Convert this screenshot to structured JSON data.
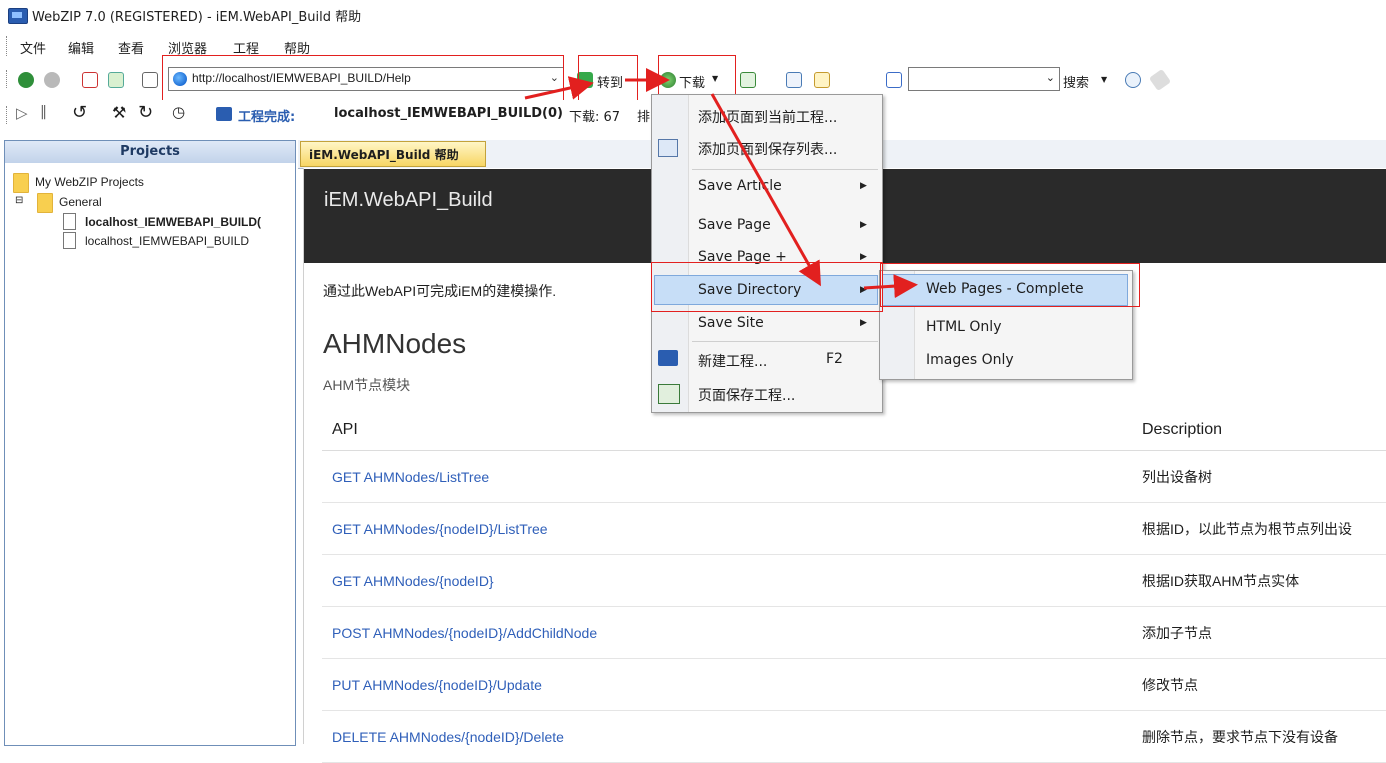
{
  "window": {
    "title": "WebZIP 7.0 (REGISTERED) - iEM.WebAPI_Build 帮助"
  },
  "menubar": {
    "items": [
      "文件",
      "编辑",
      "查看",
      "浏览器",
      "工程",
      "帮助"
    ]
  },
  "toolbar": {
    "address": "http://localhost/IEMWEBAPI_BUILD/Help",
    "go_label": "转到",
    "download_label": "下载",
    "search_label": "搜索",
    "search_value": ""
  },
  "toolbar2": {
    "status_label": "工程完成:",
    "status_project": "localhost_IEMWEBAPI_BUILD(0)",
    "status_download": "下载: 67",
    "status_cut": "排"
  },
  "projects": {
    "header": "Projects",
    "root": "My WebZIP Projects",
    "group": "General",
    "items": [
      "localhost_IEMWEBAPI_BUILD(",
      "localhost_IEMWEBAPI_BUILD"
    ]
  },
  "tab": {
    "label": "iEM.WebAPI_Build 帮助"
  },
  "page": {
    "banner_title": "iEM.WebAPI_Build",
    "intro": "通过此WebAPI可完成iEM的建模操作.",
    "section_title": "AHMNodes",
    "section_sub": "AHM节点模块",
    "table_headers": [
      "API",
      "Description"
    ],
    "rows": [
      {
        "api": "GET AHMNodes/ListTree",
        "desc": "列出设备树"
      },
      {
        "api": "GET AHMNodes/{nodeID}/ListTree",
        "desc": "根据ID，以此节点为根节点列出设"
      },
      {
        "api": "GET AHMNodes/{nodeID}",
        "desc": "根据ID获取AHM节点实体"
      },
      {
        "api": "POST AHMNodes/{nodeID}/AddChildNode",
        "desc": "添加子节点"
      },
      {
        "api": "PUT AHMNodes/{nodeID}/Update",
        "desc": "修改节点"
      },
      {
        "api": "DELETE AHMNodes/{nodeID}/Delete",
        "desc": "删除节点，要求节点下没有设备"
      }
    ]
  },
  "download_menu": {
    "items": [
      {
        "label": "添加页面到当前工程..."
      },
      {
        "label": "添加页面到保存列表..."
      },
      {
        "label": "Save Article"
      },
      {
        "label": "Save Page"
      },
      {
        "label": "Save Page +"
      },
      {
        "label": "Save Directory"
      },
      {
        "label": "Save Site"
      },
      {
        "label": "新建工程...",
        "shortcut": "F2"
      },
      {
        "label": "页面保存工程..."
      }
    ]
  },
  "save_directory_submenu": {
    "items": [
      "Web Pages - Complete",
      "HTML Only",
      "Images Only"
    ]
  },
  "colors": {
    "link": "#2f5fb9",
    "banner": "#2a2a2a",
    "highlight": "#c7def7",
    "annotation": "#e2201f"
  }
}
